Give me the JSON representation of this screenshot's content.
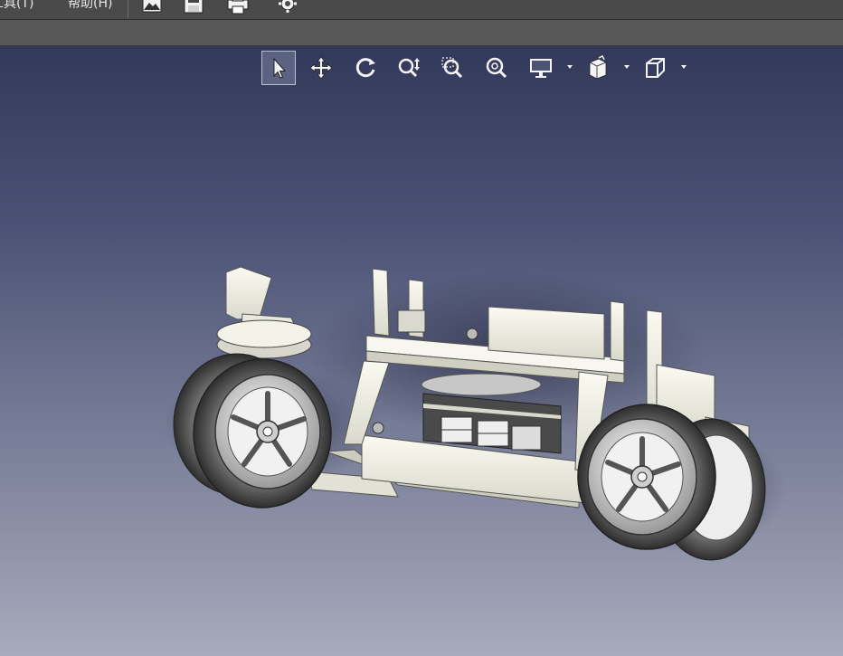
{
  "menubar": {
    "tools_label": "工具(T)",
    "help_label": "帮助(H)",
    "icons": [
      "export-image-icon",
      "save-icon",
      "print-icon",
      "settings-icon"
    ]
  },
  "view_toolbar": {
    "tools": [
      "select-icon",
      "pan-icon",
      "rotate-icon",
      "zoom-icon",
      "zoom-window-icon",
      "zoom-fit-icon",
      "display-mode-icon",
      "section-icon",
      "view-cube-icon"
    ],
    "active_tool": "select-icon"
  },
  "viewport": {
    "model": "robot-car-chassis",
    "background_top": "#33395a",
    "background_bottom": "#a7aabb"
  }
}
